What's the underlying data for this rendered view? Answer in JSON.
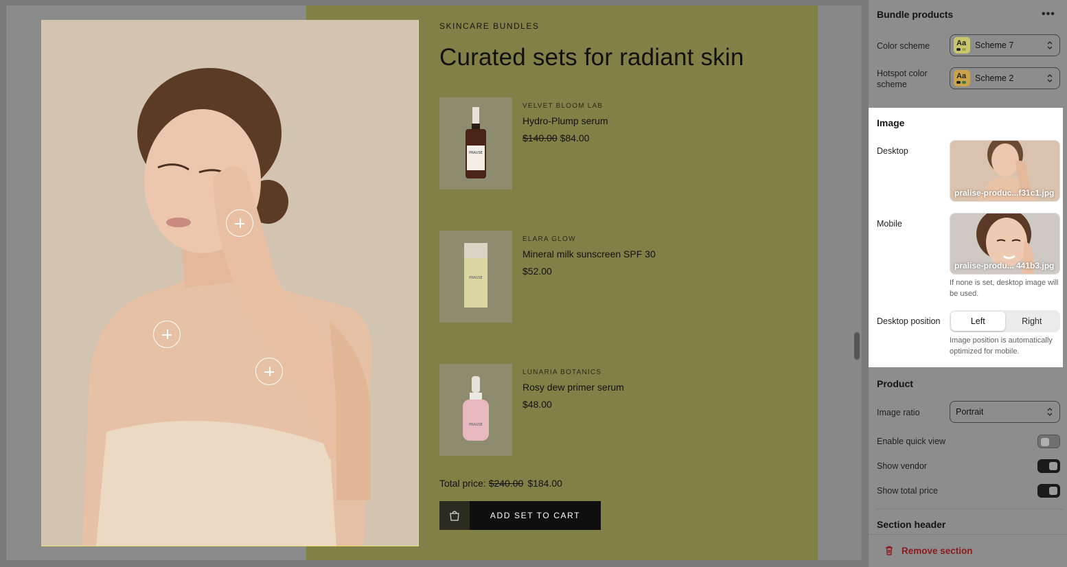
{
  "preview": {
    "eyebrow": "SKINCARE BUNDLES",
    "heading": "Curated sets for radiant skin",
    "products": [
      {
        "vendor": "VELVET BLOOM LAB",
        "name": "Hydro-Plump serum",
        "compare_price": "$140.00",
        "price": "$84.00",
        "thumb_label": "PRAUSE"
      },
      {
        "vendor": "ELARA GLOW",
        "name": "Mineral milk sunscreen SPF 30",
        "compare_price": "",
        "price": "$52.00",
        "thumb_label": "PRAUSE"
      },
      {
        "vendor": "LUNARIA BOTANICS",
        "name": "Rosy dew primer serum",
        "compare_price": "",
        "price": "$48.00",
        "thumb_label": "PRAUSE"
      }
    ],
    "total_label": "Total price:",
    "total_compare": "$240.00",
    "total_price": "$184.00",
    "add_button": "ADD SET TO CART",
    "colors": {
      "section_bg": "#818047",
      "hero_bg": "#d3c3b1",
      "button_bg": "#0f0f0f"
    }
  },
  "panel": {
    "title": "Bundle products",
    "color_scheme_label": "Color scheme",
    "color_scheme_value": "Scheme 7",
    "hotspot_label": "Hotspot color scheme",
    "hotspot_value": "Scheme 2",
    "swatch_text": "Aa",
    "image_section": "Image",
    "desktop_label": "Desktop",
    "desktop_file": "pralise-produc...f31c1.jpg",
    "mobile_label": "Mobile",
    "mobile_file": "pralise-produ... 441b3.jpg",
    "mobile_help": "If none is set, desktop image will be used.",
    "position_label": "Desktop position",
    "position_options": [
      "Left",
      "Right"
    ],
    "position_selected": "Left",
    "position_help": "Image position is automatically optimized for mobile.",
    "product_section": "Product",
    "image_ratio_label": "Image ratio",
    "image_ratio_value": "Portrait",
    "quick_view_label": "Enable quick view",
    "quick_view_on": false,
    "show_vendor_label": "Show vendor",
    "show_vendor_on": true,
    "show_total_label": "Show total price",
    "show_total_on": true,
    "section_header": "Section header",
    "remove_label": "Remove section"
  }
}
